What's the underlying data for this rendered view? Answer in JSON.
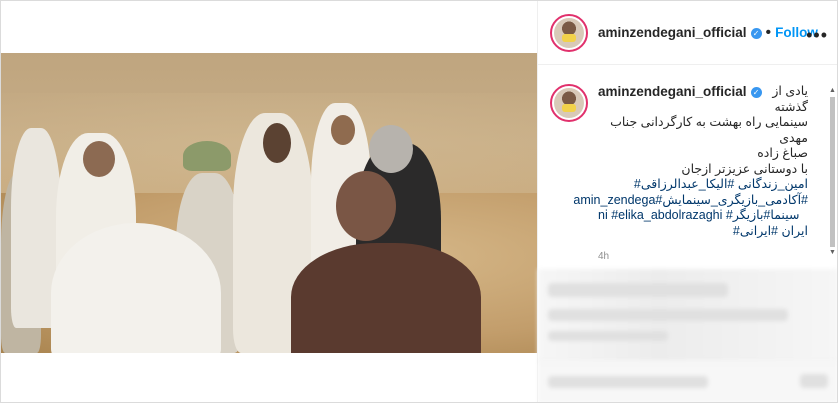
{
  "header": {
    "username": "aminzendegani_official",
    "separator": "•",
    "follow_label": "Follow",
    "more_label": "•••"
  },
  "caption": {
    "username": "aminzendegani_official",
    "lines": [
      "یادی از",
      "گذشته",
      "سینمایی راه بهشت به کارگردانی جناب مهدی",
      "صباغ زاده",
      "با دوستانی عزیزتر ازجان"
    ],
    "hashtag_lines": [
      "امین_زندگانی #الیکا_عبدالرزاقی#",
      "#آکادمی_بازیگری_سینمایش#amin_zendega",
      "ni #elika_abdolrazaghi #سینما#بازیگر",
      "ایران #ایرانی#"
    ],
    "time": "4h"
  },
  "colors": {
    "accent": "#0095f6",
    "hashtag": "#00376b",
    "avatar_ring": "#e1306c"
  }
}
